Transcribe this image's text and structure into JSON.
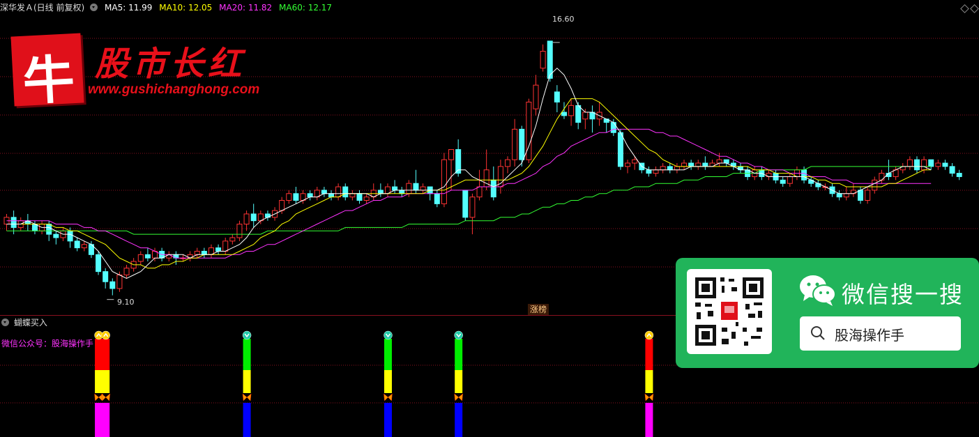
{
  "header": {
    "title": "深华发Ａ(日线 前复权)",
    "ma": [
      {
        "label": "MA5: 11.99",
        "color": "#ffffff"
      },
      {
        "label": "MA10: 12.05",
        "color": "#ffff00"
      },
      {
        "label": "MA20: 11.82",
        "color": "#ff33ff"
      },
      {
        "label": "MA60: 12.17",
        "color": "#33ff33"
      }
    ]
  },
  "price_labels": {
    "high": "16.60",
    "low": "9.10"
  },
  "event_tag": "涨榜",
  "logo": {
    "char": "牛",
    "title": "股市长红",
    "url": "www.gushichanghong.com"
  },
  "wechat": {
    "title": "微信搜一搜",
    "search": "股海操作手"
  },
  "sub_pane": {
    "title": "蝴蝶买入",
    "note": "微信公众号：股海操作手"
  },
  "colors": {
    "up": "#ff3333",
    "down": "#54ffff",
    "grid": "#8a1020",
    "ma5": "#ffffff",
    "ma10": "#ffff00",
    "ma20": "#ff33ff",
    "ma60": "#33ff33"
  },
  "chart_data": {
    "type": "candlestick",
    "ylim": [
      8.6,
      17.4
    ],
    "candles": [
      [
        11.2,
        11.4,
        11.0,
        11.5
      ],
      [
        11.4,
        11.1,
        10.9,
        11.6
      ],
      [
        11.1,
        11.3,
        11.0,
        11.4
      ],
      [
        11.3,
        11.2,
        11.0,
        11.5
      ],
      [
        11.2,
        11.0,
        10.9,
        11.3
      ],
      [
        11.0,
        11.2,
        10.9,
        11.3
      ],
      [
        11.2,
        10.9,
        10.7,
        11.3
      ],
      [
        10.9,
        10.8,
        10.6,
        11.0
      ],
      [
        10.8,
        11.0,
        10.7,
        11.1
      ],
      [
        11.0,
        10.7,
        10.5,
        11.1
      ],
      [
        10.7,
        10.5,
        10.4,
        10.8
      ],
      [
        10.5,
        10.6,
        10.4,
        10.7
      ],
      [
        10.6,
        10.3,
        10.2,
        10.7
      ],
      [
        10.3,
        9.8,
        9.7,
        10.4
      ],
      [
        9.8,
        9.5,
        9.3,
        9.9
      ],
      [
        9.5,
        9.3,
        9.1,
        9.6
      ],
      [
        9.3,
        9.7,
        9.2,
        9.8
      ],
      [
        9.7,
        9.9,
        9.6,
        10.0
      ],
      [
        9.9,
        10.1,
        9.8,
        10.2
      ],
      [
        10.1,
        10.3,
        10.0,
        10.4
      ],
      [
        10.3,
        10.2,
        10.1,
        10.5
      ],
      [
        10.2,
        10.4,
        10.1,
        10.5
      ],
      [
        10.4,
        10.2,
        10.1,
        10.5
      ],
      [
        10.2,
        10.3,
        10.1,
        10.4
      ],
      [
        10.3,
        10.2,
        10.0,
        10.4
      ],
      [
        10.2,
        10.2,
        10.1,
        10.3
      ],
      [
        10.2,
        10.3,
        10.1,
        10.4
      ],
      [
        10.3,
        10.4,
        10.2,
        10.5
      ],
      [
        10.4,
        10.3,
        10.2,
        10.5
      ],
      [
        10.3,
        10.5,
        10.2,
        10.6
      ],
      [
        10.5,
        10.4,
        10.3,
        10.6
      ],
      [
        10.4,
        10.7,
        10.3,
        10.8
      ],
      [
        10.7,
        10.8,
        10.6,
        10.9
      ],
      [
        10.8,
        11.2,
        10.7,
        11.3
      ],
      [
        11.2,
        11.5,
        11.0,
        11.6
      ],
      [
        11.5,
        11.3,
        11.1,
        11.8
      ],
      [
        11.3,
        11.5,
        11.2,
        11.6
      ],
      [
        11.5,
        11.4,
        11.3,
        11.6
      ],
      [
        11.4,
        11.6,
        11.3,
        11.7
      ],
      [
        11.6,
        11.9,
        11.5,
        12.0
      ],
      [
        11.9,
        12.1,
        11.8,
        12.2
      ],
      [
        12.1,
        11.9,
        11.8,
        12.3
      ],
      [
        11.9,
        12.1,
        11.8,
        12.2
      ],
      [
        12.1,
        12.0,
        11.9,
        12.2
      ],
      [
        12.0,
        12.2,
        11.9,
        12.3
      ],
      [
        12.2,
        12.1,
        12.0,
        12.3
      ],
      [
        12.1,
        12.0,
        11.9,
        12.2
      ],
      [
        12.0,
        12.3,
        11.9,
        12.4
      ],
      [
        12.3,
        12.0,
        11.9,
        12.4
      ],
      [
        12.0,
        12.1,
        11.9,
        12.2
      ],
      [
        12.1,
        11.9,
        11.8,
        12.2
      ],
      [
        11.9,
        12.0,
        11.8,
        12.1
      ],
      [
        12.0,
        12.2,
        11.9,
        12.4
      ],
      [
        12.2,
        12.1,
        12.0,
        12.4
      ],
      [
        12.1,
        12.3,
        12.0,
        12.4
      ],
      [
        12.3,
        12.2,
        12.1,
        12.5
      ],
      [
        12.2,
        12.1,
        12.0,
        12.3
      ],
      [
        12.1,
        12.4,
        12.0,
        12.5
      ],
      [
        12.4,
        12.2,
        12.1,
        12.8
      ],
      [
        12.2,
        12.3,
        12.1,
        12.4
      ],
      [
        12.3,
        12.1,
        11.9,
        12.3
      ],
      [
        12.1,
        11.8,
        11.7,
        12.2
      ],
      [
        11.8,
        13.1,
        11.7,
        13.3
      ],
      [
        13.1,
        13.4,
        12.2,
        13.4
      ],
      [
        13.4,
        12.7,
        12.6,
        13.7
      ],
      [
        12.2,
        11.4,
        11.3,
        12.2
      ],
      [
        11.4,
        12.0,
        10.9,
        12.1
      ],
      [
        12.0,
        12.3,
        11.9,
        12.8
      ],
      [
        12.3,
        12.8,
        12.2,
        13.4
      ],
      [
        12.5,
        12.0,
        11.9,
        12.9
      ],
      [
        12.3,
        12.9,
        12.1,
        13.1
      ],
      [
        12.9,
        13.1,
        12.7,
        13.2
      ],
      [
        13.1,
        14.0,
        12.9,
        14.3
      ],
      [
        14.0,
        13.1,
        12.9,
        14.1
      ],
      [
        13.1,
        14.8,
        13.0,
        14.9
      ],
      [
        14.6,
        15.3,
        14.4,
        15.6
      ],
      [
        15.8,
        16.3,
        15.7,
        16.5
      ],
      [
        16.6,
        15.5,
        15.4,
        16.6
      ],
      [
        15.1,
        14.8,
        14.5,
        15.3
      ],
      [
        14.5,
        14.4,
        14.3,
        14.8
      ],
      [
        14.4,
        14.7,
        14.1,
        14.9
      ],
      [
        14.7,
        14.2,
        14.0,
        14.8
      ],
      [
        14.3,
        14.5,
        14.0,
        14.6
      ],
      [
        14.5,
        14.3,
        13.9,
        14.7
      ],
      [
        14.3,
        14.5,
        14.1,
        14.8
      ],
      [
        14.3,
        14.2,
        13.9,
        14.3
      ],
      [
        14.2,
        13.9,
        13.8,
        14.3
      ],
      [
        13.9,
        12.9,
        12.8,
        14.0
      ],
      [
        12.9,
        13.0,
        12.7,
        13.1
      ],
      [
        13.0,
        13.1,
        12.8,
        13.2
      ],
      [
        13.0,
        12.8,
        12.7,
        13.0
      ],
      [
        12.8,
        12.7,
        12.6,
        12.9
      ],
      [
        12.7,
        12.8,
        12.6,
        12.9
      ],
      [
        12.8,
        12.9,
        12.7,
        13.0
      ],
      [
        12.9,
        12.8,
        12.7,
        13.0
      ],
      [
        12.8,
        12.9,
        12.7,
        13.0
      ],
      [
        12.9,
        13.0,
        12.8,
        13.1
      ],
      [
        13.0,
        12.9,
        12.8,
        13.1
      ],
      [
        12.9,
        13.0,
        12.8,
        13.1
      ],
      [
        13.0,
        12.9,
        12.8,
        13.2
      ],
      [
        12.9,
        13.0,
        12.9,
        13.1
      ],
      [
        13.0,
        13.1,
        12.9,
        13.3
      ],
      [
        13.1,
        13.0,
        12.9,
        13.1
      ],
      [
        13.0,
        12.9,
        12.8,
        13.1
      ],
      [
        12.9,
        12.8,
        12.7,
        13.0
      ],
      [
        12.8,
        12.6,
        12.5,
        12.9
      ],
      [
        12.6,
        12.8,
        12.5,
        12.9
      ],
      [
        12.8,
        12.6,
        12.5,
        12.9
      ],
      [
        12.6,
        12.7,
        12.5,
        12.8
      ],
      [
        12.7,
        12.5,
        12.4,
        12.8
      ],
      [
        12.5,
        12.4,
        12.3,
        12.6
      ],
      [
        12.4,
        12.6,
        12.3,
        12.7
      ],
      [
        12.6,
        12.8,
        12.5,
        12.9
      ],
      [
        12.8,
        12.5,
        12.4,
        12.9
      ],
      [
        12.5,
        12.4,
        12.3,
        12.6
      ],
      [
        12.4,
        12.3,
        12.2,
        12.5
      ],
      [
        12.3,
        12.3,
        12.2,
        12.4
      ],
      [
        12.3,
        12.1,
        12.0,
        12.4
      ],
      [
        12.1,
        12.0,
        11.9,
        12.2
      ],
      [
        12.0,
        12.1,
        11.9,
        12.3
      ],
      [
        12.1,
        12.2,
        12.0,
        12.4
      ],
      [
        12.2,
        11.9,
        11.8,
        12.3
      ],
      [
        11.9,
        12.2,
        11.8,
        12.3
      ],
      [
        12.2,
        12.5,
        12.1,
        12.6
      ],
      [
        12.5,
        12.7,
        12.4,
        12.8
      ],
      [
        12.7,
        12.6,
        12.5,
        13.1
      ],
      [
        12.6,
        12.8,
        12.5,
        12.9
      ],
      [
        12.8,
        12.9,
        12.7,
        13.0
      ],
      [
        12.9,
        13.1,
        12.8,
        13.2
      ],
      [
        13.1,
        12.8,
        12.7,
        13.2
      ],
      [
        12.8,
        13.1,
        12.7,
        13.2
      ],
      [
        13.1,
        12.9,
        12.8,
        13.1
      ],
      [
        12.9,
        13.0,
        12.8,
        13.1
      ],
      [
        13.0,
        12.9,
        12.8,
        13.1
      ],
      [
        12.9,
        12.7,
        12.6,
        13.0
      ],
      [
        12.7,
        12.6,
        12.5,
        12.8
      ]
    ],
    "ma5": [
      11.2,
      11.2,
      11.2,
      11.3,
      11.2,
      11.1,
      11.1,
      11.0,
      10.9,
      10.9,
      10.8,
      10.7,
      10.6,
      10.4,
      10.1,
      9.8,
      9.7,
      9.6,
      9.7,
      9.8,
      10.0,
      10.2,
      10.2,
      10.3,
      10.3,
      10.3,
      10.2,
      10.3,
      10.3,
      10.3,
      10.4,
      10.4,
      10.5,
      10.6,
      10.8,
      11.1,
      11.3,
      11.4,
      11.5,
      11.6,
      11.7,
      11.8,
      11.9,
      12.0,
      12.0,
      12.1,
      12.1,
      12.1,
      12.1,
      12.1,
      12.1,
      12.1,
      12.0,
      12.1,
      12.1,
      12.2,
      12.2,
      12.2,
      12.2,
      12.2,
      12.2,
      12.2,
      12.3,
      12.6,
      12.8,
      12.8,
      12.6,
      12.5,
      12.4,
      12.3,
      12.4,
      12.6,
      12.8,
      13.0,
      13.5,
      14.1,
      14.9,
      15.6,
      15.8,
      15.6,
      15.2,
      14.7,
      14.5,
      14.5,
      14.4,
      14.3,
      14.2,
      13.9,
      13.5,
      13.2,
      12.9,
      12.8,
      12.8,
      12.8,
      12.8,
      12.8,
      12.8,
      12.9,
      12.9,
      12.9,
      12.9,
      13.0,
      13.0,
      12.9,
      12.8,
      12.8,
      12.7,
      12.7,
      12.6,
      12.6,
      12.6,
      12.6,
      12.6,
      12.6,
      12.5,
      12.4,
      12.3,
      12.2,
      12.1,
      12.1,
      12.1,
      12.2,
      12.3,
      12.4,
      12.5,
      12.7,
      12.8,
      12.9,
      12.9,
      12.9,
      12.9,
      12.8
    ],
    "ma10": [
      11.2,
      11.2,
      11.2,
      11.2,
      11.2,
      11.2,
      11.2,
      11.1,
      11.1,
      11.0,
      11.0,
      10.9,
      10.8,
      10.7,
      10.6,
      10.4,
      10.2,
      10.1,
      10.0,
      10.0,
      9.9,
      9.9,
      10.0,
      10.0,
      10.1,
      10.1,
      10.2,
      10.2,
      10.3,
      10.3,
      10.3,
      10.3,
      10.3,
      10.4,
      10.5,
      10.6,
      10.8,
      10.9,
      11.0,
      11.2,
      11.3,
      11.5,
      11.6,
      11.7,
      11.8,
      11.9,
      12.0,
      12.0,
      12.1,
      12.1,
      12.1,
      12.1,
      12.1,
      12.1,
      12.1,
      12.1,
      12.1,
      12.1,
      12.1,
      12.1,
      12.2,
      12.2,
      12.2,
      12.3,
      12.4,
      12.5,
      12.5,
      12.5,
      12.5,
      12.5,
      12.5,
      12.5,
      12.6,
      12.7,
      12.9,
      13.2,
      13.5,
      13.9,
      14.3,
      14.6,
      14.9,
      14.9,
      14.9,
      14.9,
      14.8,
      14.6,
      14.4,
      14.2,
      14.0,
      13.8,
      13.6,
      13.4,
      13.3,
      13.1,
      13.0,
      12.9,
      12.9,
      12.9,
      12.9,
      12.9,
      12.9,
      12.9,
      12.9,
      12.9,
      12.9,
      12.9,
      12.8,
      12.8,
      12.8,
      12.7,
      12.7,
      12.7,
      12.6,
      12.6,
      12.6,
      12.5,
      12.5,
      12.4,
      12.4,
      12.3,
      12.3,
      12.3,
      12.3,
      12.3,
      12.3,
      12.4,
      12.4,
      12.5,
      12.6,
      12.7,
      12.8,
      12.8
    ],
    "ma20": [
      11.3,
      11.3,
      11.3,
      11.3,
      11.3,
      11.3,
      11.3,
      11.2,
      11.2,
      11.2,
      11.2,
      11.1,
      11.1,
      11.0,
      11.0,
      10.9,
      10.8,
      10.7,
      10.6,
      10.5,
      10.5,
      10.4,
      10.3,
      10.3,
      10.2,
      10.2,
      10.2,
      10.2,
      10.2,
      10.2,
      10.2,
      10.2,
      10.3,
      10.3,
      10.4,
      10.4,
      10.5,
      10.6,
      10.6,
      10.7,
      10.8,
      10.9,
      11.0,
      11.1,
      11.2,
      11.3,
      11.4,
      11.5,
      11.6,
      11.6,
      11.7,
      11.8,
      11.9,
      11.9,
      12.0,
      12.0,
      12.0,
      12.1,
      12.1,
      12.1,
      12.1,
      12.1,
      12.1,
      12.2,
      12.2,
      12.2,
      12.2,
      12.3,
      12.3,
      12.3,
      12.3,
      12.4,
      12.4,
      12.5,
      12.6,
      12.7,
      12.9,
      13.0,
      13.2,
      13.3,
      13.5,
      13.6,
      13.7,
      13.8,
      13.9,
      13.9,
      14.0,
      14.0,
      14.0,
      14.0,
      14.0,
      14.0,
      13.9,
      13.9,
      13.8,
      13.8,
      13.7,
      13.6,
      13.5,
      13.4,
      13.3,
      13.2,
      13.2,
      13.1,
      13.0,
      13.0,
      12.9,
      12.9,
      12.8,
      12.8,
      12.8,
      12.7,
      12.7,
      12.7,
      12.6,
      12.6,
      12.6,
      12.5,
      12.5,
      12.5,
      12.4,
      12.4,
      12.4,
      12.4,
      12.4,
      12.4,
      12.4,
      12.4,
      12.4,
      12.4,
      12.4,
      12.4
    ],
    "ma60": [
      11.0,
      11.0,
      11.0,
      11.0,
      11.0,
      11.0,
      11.0,
      11.0,
      11.0,
      11.0,
      11.0,
      11.0,
      11.0,
      11.0,
      11.0,
      11.0,
      11.0,
      11.0,
      10.9,
      10.9,
      10.9,
      10.9,
      10.9,
      10.9,
      10.9,
      10.9,
      10.9,
      10.9,
      10.9,
      10.9,
      10.9,
      10.9,
      10.9,
      10.9,
      10.9,
      10.9,
      10.9,
      11.0,
      11.0,
      11.0,
      11.0,
      11.0,
      11.0,
      11.0,
      11.0,
      11.0,
      11.0,
      11.0,
      11.1,
      11.1,
      11.1,
      11.1,
      11.1,
      11.1,
      11.1,
      11.1,
      11.1,
      11.2,
      11.2,
      11.2,
      11.2,
      11.2,
      11.2,
      11.2,
      11.2,
      11.3,
      11.3,
      11.3,
      11.3,
      11.3,
      11.4,
      11.4,
      11.4,
      11.5,
      11.5,
      11.6,
      11.7,
      11.7,
      11.8,
      11.8,
      11.9,
      11.9,
      12.0,
      12.0,
      12.1,
      12.1,
      12.2,
      12.2,
      12.2,
      12.3,
      12.3,
      12.3,
      12.4,
      12.4,
      12.4,
      12.4,
      12.5,
      12.5,
      12.5,
      12.6,
      12.6,
      12.6,
      12.6,
      12.7,
      12.7,
      12.7,
      12.7,
      12.8,
      12.8,
      12.8,
      12.8,
      12.8,
      12.8,
      12.8,
      12.9,
      12.9,
      12.9,
      12.9,
      12.9,
      12.9,
      12.9,
      12.9,
      12.9,
      12.9,
      12.9,
      12.9,
      12.9,
      12.9,
      12.9,
      12.9,
      12.9,
      12.9
    ],
    "signals": [
      {
        "index": 13,
        "top": "#ff0000",
        "bottom": "#ff00ff",
        "marker": "up"
      },
      {
        "index": 14,
        "top": "#ff0000",
        "bottom": "#ff00ff",
        "marker": "up"
      },
      {
        "index": 34,
        "top": "#00ee00",
        "bottom": "#0000ff",
        "marker": "down"
      },
      {
        "index": 54,
        "top": "#00ee00",
        "bottom": "#0000ff",
        "marker": "down"
      },
      {
        "index": 64,
        "top": "#00ee00",
        "bottom": "#0000ff",
        "marker": "down"
      },
      {
        "index": 91,
        "top": "#ff0000",
        "bottom": "#ff00ff",
        "marker": "up"
      }
    ]
  }
}
